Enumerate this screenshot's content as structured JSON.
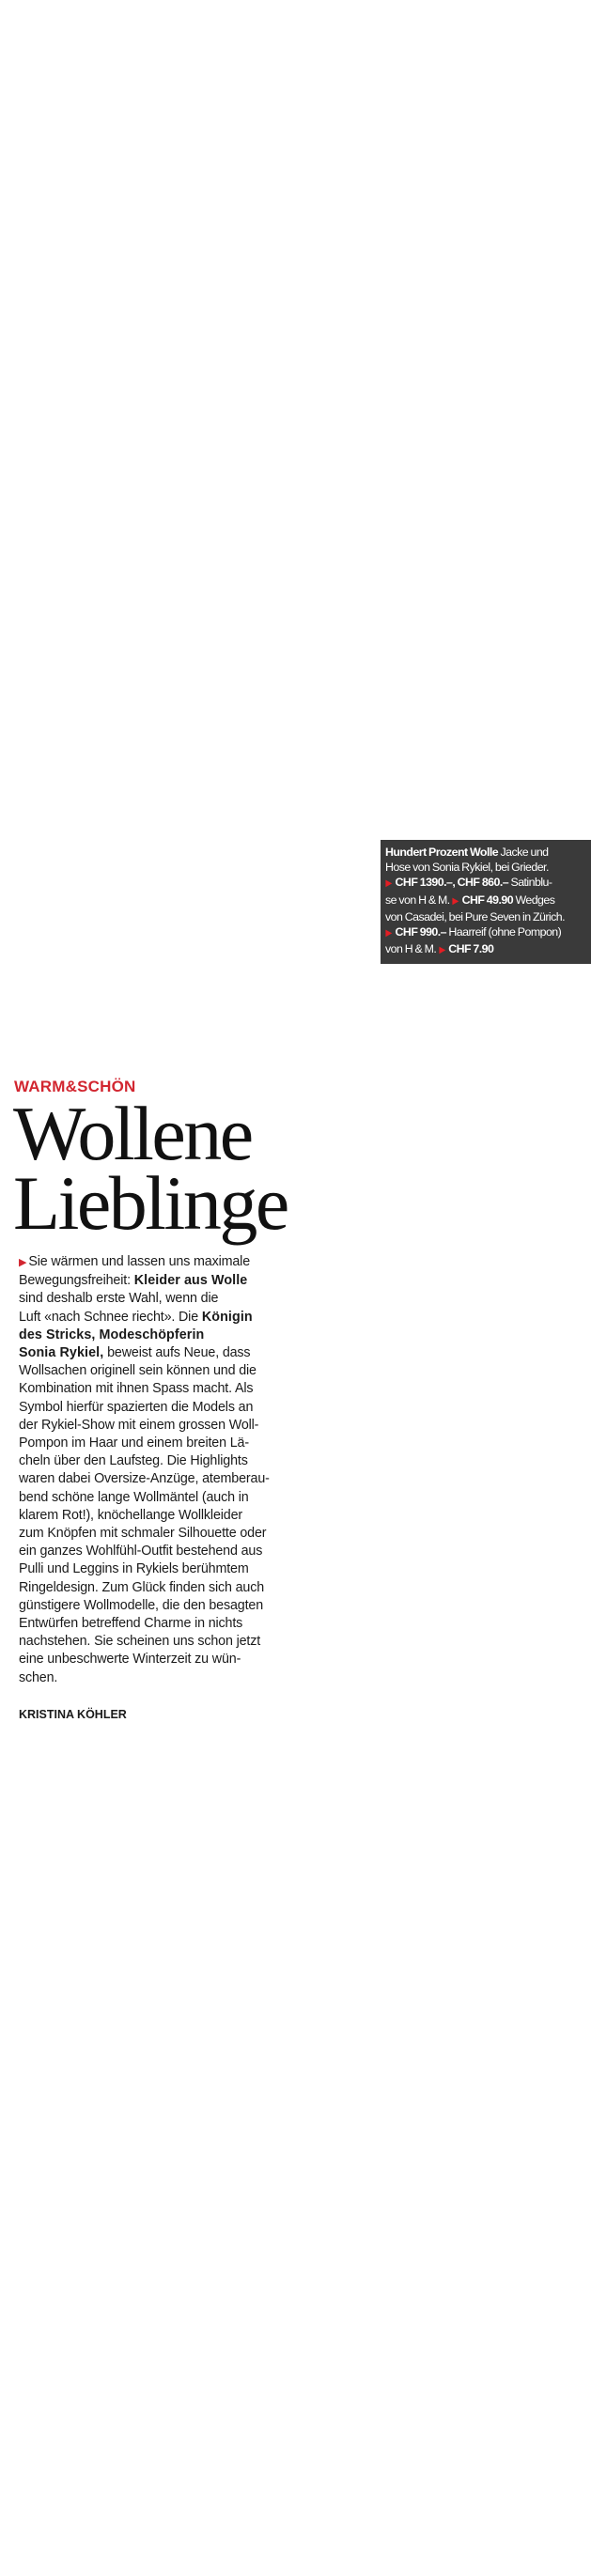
{
  "caption": {
    "title": "Hundert Prozent Wolle",
    "lines": [
      {
        "parts": [
          {
            "t": "Hundert Prozent Wolle",
            "b": true
          },
          {
            "t": " Jacke und",
            "b": false
          }
        ]
      },
      {
        "parts": [
          {
            "t": "Hose von Sonia Rykiel, bei Grieder.",
            "b": false
          }
        ]
      },
      {
        "parts": [
          {
            "t": "▶",
            "arrow": true
          },
          {
            "t": " CHF 1390.–,  CHF 860.–",
            "b": true
          },
          {
            "t": " Satinblu-",
            "b": false
          }
        ]
      },
      {
        "parts": [
          {
            "t": "se von H & M. ",
            "b": false
          },
          {
            "t": "▶",
            "arrow": true
          },
          {
            "t": " CHF 49.90",
            "b": true
          },
          {
            "t": " Wedges",
            "b": false
          }
        ]
      },
      {
        "parts": [
          {
            "t": "von Casadei, bei Pure Seven in Zürich.",
            "b": false
          }
        ]
      },
      {
        "parts": [
          {
            "t": "▶",
            "arrow": true
          },
          {
            "t": " CHF 990.–",
            "b": true
          },
          {
            "t": " Haarreif (ohne Pompon)",
            "b": false
          }
        ]
      },
      {
        "parts": [
          {
            "t": "von H & M. ",
            "b": false
          },
          {
            "t": "▶",
            "arrow": true
          },
          {
            "t": " CHF 7.90",
            "b": true
          }
        ]
      }
    ]
  },
  "article": {
    "kicker": "WARM&SCHÖN",
    "headline": [
      "Wollene",
      "Lieblinge"
    ],
    "body_lines": [
      [
        {
          "arrow": true
        },
        {
          "t": "Sie wärmen und lassen uns maximale"
        }
      ],
      [
        {
          "t": "Bewegungsfreiheit: "
        },
        {
          "t": "Kleider aus Wolle",
          "b": true
        }
      ],
      [
        {
          "t": "sind deshalb erste Wahl, wenn die"
        }
      ],
      [
        {
          "t": "Luft «nach Schnee riecht». Die "
        },
        {
          "t": "Königin",
          "b": true
        }
      ],
      [
        {
          "t": "des Stricks, Modeschöpferin",
          "b": true
        }
      ],
      [
        {
          "t": "Sonia Rykiel,",
          "b": true
        },
        {
          "t": " beweist aufs Neue, dass"
        }
      ],
      [
        {
          "t": "Wollsachen originell sein können und die"
        }
      ],
      [
        {
          "t": "Kombination mit ihnen Spass macht. Als"
        }
      ],
      [
        {
          "t": "Symbol hierfür spazierten die Models an"
        }
      ],
      [
        {
          "t": "der Rykiel-Show mit einem grossen Woll-"
        }
      ],
      [
        {
          "t": "Pompon im Haar und einem breiten Lä-"
        }
      ],
      [
        {
          "t": "cheln über den Laufsteg. Die Highlights"
        }
      ],
      [
        {
          "t": "waren dabei Oversize-Anzüge, atemberau-"
        }
      ],
      [
        {
          "t": "bend schöne lange Wollmäntel (auch in"
        }
      ],
      [
        {
          "t": "klarem Rot!), knöchellange Wollkleider"
        }
      ],
      [
        {
          "t": "zum Knöpfen mit schmaler Silhouette oder"
        }
      ],
      [
        {
          "t": "ein ganzes Wohlfühl-Outfit bestehend aus"
        }
      ],
      [
        {
          "t": "Pulli und Leggins in Rykiels berühmtem"
        }
      ],
      [
        {
          "t": "Ringeldesign. Zum Glück finden sich auch"
        }
      ],
      [
        {
          "t": "günstigere Wollmodelle, die den besagten"
        }
      ],
      [
        {
          "t": "Entwürfen betreffend Charme in nichts"
        }
      ],
      [
        {
          "t": "nachstehen. Sie scheinen uns schon jetzt"
        }
      ],
      [
        {
          "t": "eine unbeschwerte Winterzeit zu wün-"
        }
      ],
      [
        {
          "t": "schen."
        }
      ]
    ],
    "author": "KRISTINA KÖHLER"
  },
  "colors": {
    "accent_red": "#d22630",
    "caption_bg": "#3a3a3a",
    "text": "#111111"
  },
  "icons": {
    "bullet": "play-arrow-icon"
  }
}
